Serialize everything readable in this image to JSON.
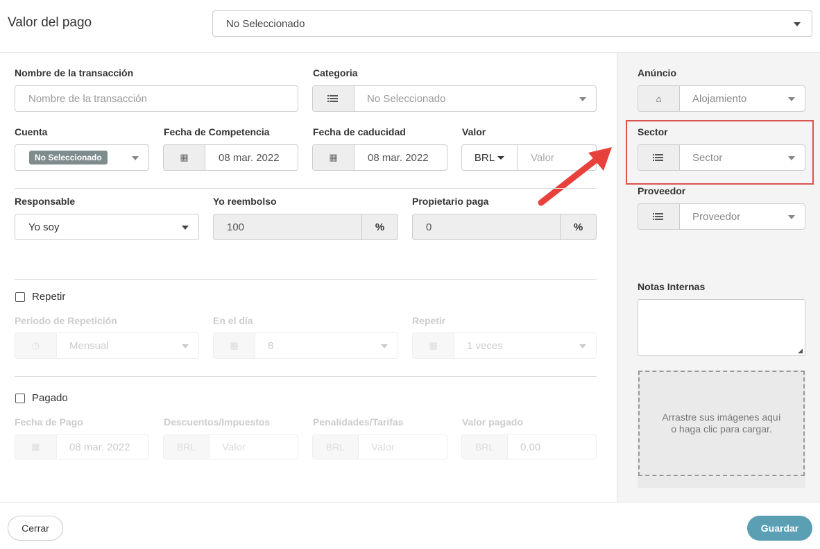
{
  "header": {
    "title": "Valor del pago",
    "select_value": "No Seleccionado"
  },
  "form": {
    "nombre": {
      "label": "Nombre de la transacción",
      "placeholder": "Nombre de la transacción"
    },
    "categoria": {
      "label": "Categoria",
      "value": "No Seleccionado"
    },
    "cuenta": {
      "label": "Cuenta",
      "badge": "No Seleccionado"
    },
    "fecha_competencia": {
      "label": "Fecha de Competencia",
      "value": "08 mar. 2022"
    },
    "fecha_caducidad": {
      "label": "Fecha de caducidad",
      "value": "08 mar. 2022"
    },
    "valor": {
      "label": "Valor",
      "currency": "BRL",
      "placeholder": "Valor"
    },
    "responsable": {
      "label": "Responsable",
      "value": "Yo soy"
    },
    "yo_reembolso": {
      "label": "Yo reembolso",
      "value": "100",
      "unit": "%"
    },
    "propietario_paga": {
      "label": "Propietario paga",
      "value": "0",
      "unit": "%"
    },
    "repetir": {
      "label": "Repetir",
      "checked": false
    },
    "periodo": {
      "label": "Periodo de Repetición",
      "value": "Mensual"
    },
    "en_el_dia": {
      "label": "En el día",
      "value": "8"
    },
    "repetir_veces": {
      "label": "Repetir",
      "value": "1 veces"
    },
    "pagado": {
      "label": "Pagado",
      "checked": false
    },
    "fecha_pago": {
      "label": "Fecha de Pago",
      "value": "08 mar. 2022"
    },
    "descuentos": {
      "label": "Descuentos/Impuestos",
      "currency": "BRL",
      "placeholder": "Valor"
    },
    "penalidades": {
      "label": "Penalidades/Tarifas",
      "currency": "BRL",
      "placeholder": "Valor"
    },
    "valor_pagado": {
      "label": "Valor pagado",
      "currency": "BRL",
      "value": "0.00"
    }
  },
  "sidebar": {
    "anuncio": {
      "label": "Anúncio",
      "value": "Alojamiento"
    },
    "sector": {
      "label": "Sector",
      "value": "Sector"
    },
    "proveedor": {
      "label": "Proveedor",
      "value": "Proveedor"
    },
    "notas": {
      "label": "Notas Internas"
    },
    "dropzone": {
      "text": "Arrastre sus imágenes aquí o haga clic para cargar."
    }
  },
  "footer": {
    "close_label": "Cerrar",
    "save_label": "Guardar"
  },
  "colors": {
    "highlight": "#d9534f",
    "arrow": "#e8413c",
    "save_button": "#5a9fb4",
    "badge": "#7f8c8d"
  }
}
